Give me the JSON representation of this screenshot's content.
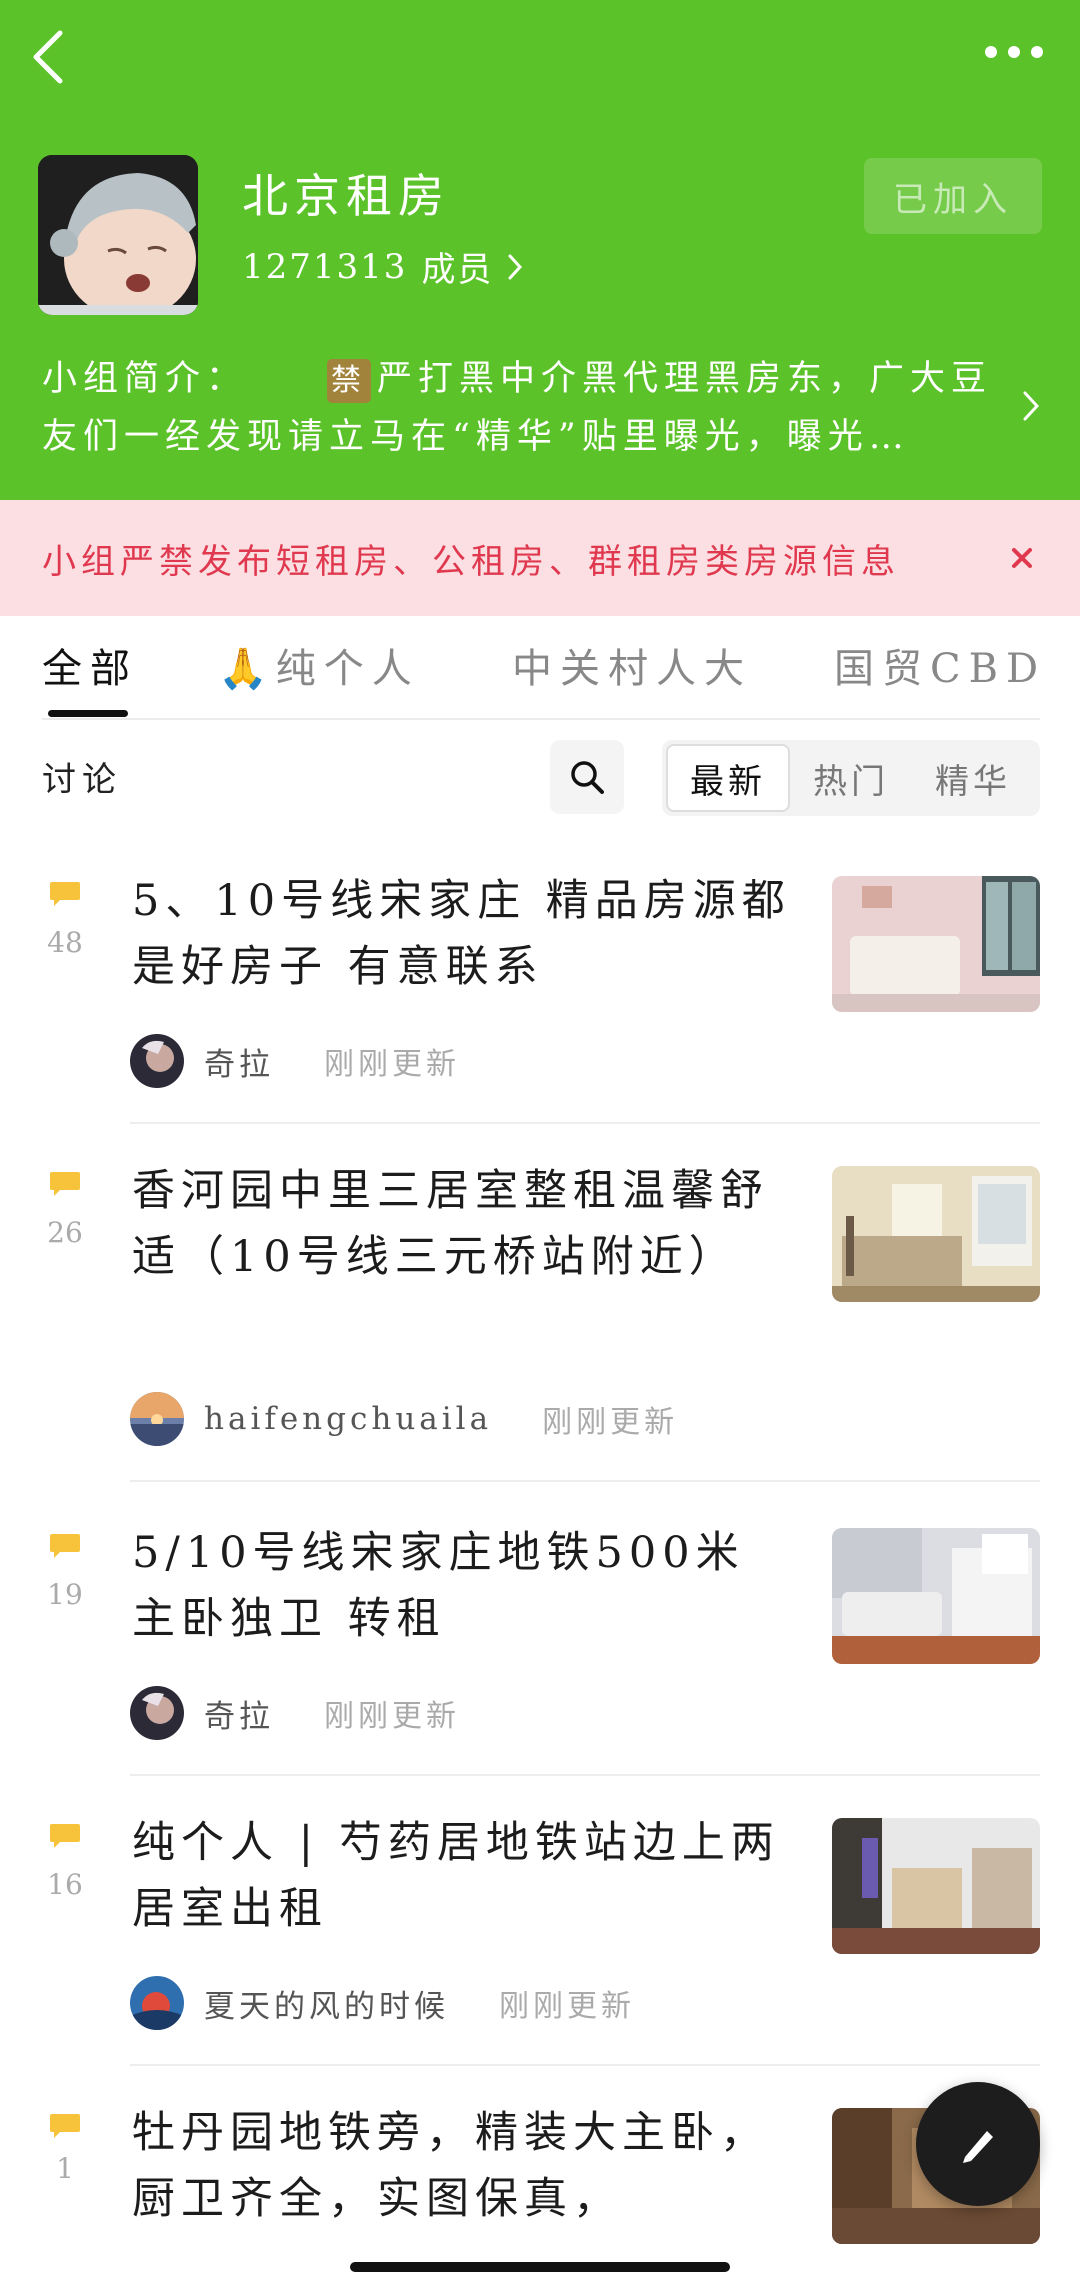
{
  "colors": {
    "header": "#5cc229",
    "notice_bg": "#fbdfe2",
    "notice_text": "#e0394f",
    "count_icon": "#f6c33a"
  },
  "header": {
    "title": "北京租房",
    "member_count": "1271313",
    "member_label": "成员",
    "join_button": "已加入",
    "intro_label": "小组简介：",
    "intro_badge": "禁",
    "intro_text": "严打黑中介黑代理黑房东，广大豆友们一经发现请立马在“精华”贴里曝光，曝光…"
  },
  "notice": {
    "text": "小组严禁发布短租房、公租房、群租房类房源信息"
  },
  "tabs": [
    {
      "label": "全部",
      "active": true
    },
    {
      "label": "🙏纯个人",
      "active": false
    },
    {
      "label": "中关村人大",
      "active": false
    },
    {
      "label": "国贸CBD",
      "active": false
    }
  ],
  "discussion": {
    "label": "讨论",
    "sort": [
      "最新",
      "热门",
      "精华"
    ]
  },
  "posts": [
    {
      "count": "48",
      "title": "5、10号线宋家庄 精品房源都是好房子 有意联系",
      "author": "奇拉",
      "time": "刚刚更新"
    },
    {
      "count": "26",
      "title": "香河园中里三居室整租温馨舒适（10号线三元桥站附近）",
      "author": "haifengchuaila",
      "time": "刚刚更新"
    },
    {
      "count": "19",
      "title": "5/10号线宋家庄地铁500米 主卧独卫 转租",
      "author": "奇拉",
      "time": "刚刚更新"
    },
    {
      "count": "16",
      "title": "纯个人 | 芍药居地铁站边上两居室出租",
      "author": "夏天的风的时候",
      "time": "刚刚更新"
    },
    {
      "count": "1",
      "title": "牡丹园地铁旁，精装大主卧，厨卫齐全，实图保真，",
      "author": "",
      "time": ""
    }
  ]
}
